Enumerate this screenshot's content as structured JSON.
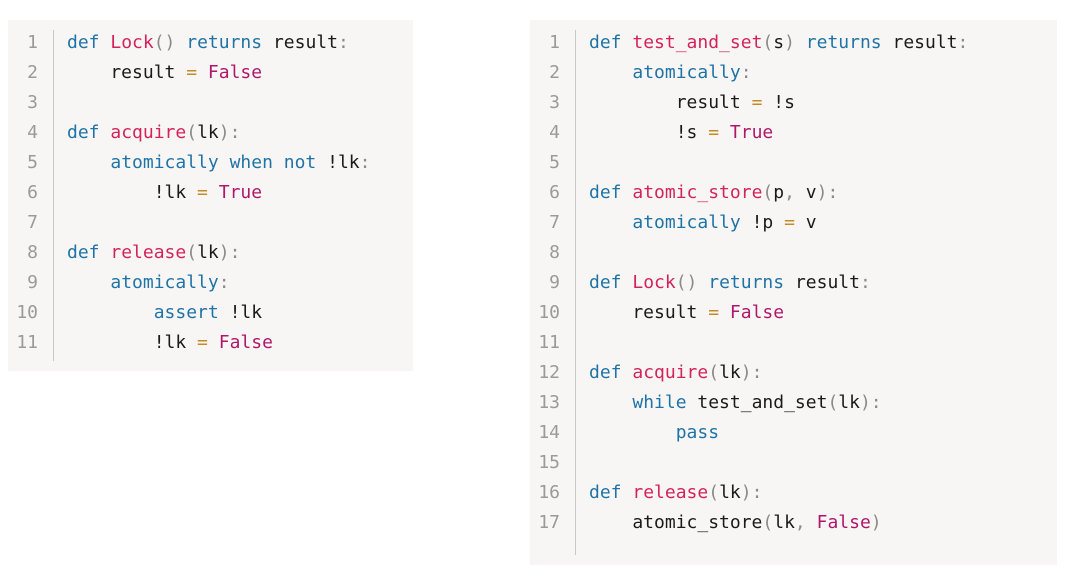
{
  "colors": {
    "keyword": "#1f73a6",
    "function": "#d4235c",
    "literal": "#b0176b",
    "operator": "#c48a2a",
    "punctuation": "#8a8a8a",
    "text": "#1a1a1a",
    "line_number": "#9a9a9a",
    "panel_background": "#f7f6f4"
  },
  "left_listing": {
    "lines": [
      {
        "n": "1",
        "tokens": [
          [
            "kw",
            "def "
          ],
          [
            "fn",
            "Lock"
          ],
          [
            "pn",
            "()"
          ],
          [
            "tx",
            " "
          ],
          [
            "kw",
            "returns"
          ],
          [
            "tx",
            " result"
          ],
          [
            "pn",
            ":"
          ]
        ]
      },
      {
        "n": "2",
        "tokens": [
          [
            "tx",
            "    result "
          ],
          [
            "op",
            "="
          ],
          [
            "tx",
            " "
          ],
          [
            "lit",
            "False"
          ]
        ]
      },
      {
        "n": "3",
        "tokens": []
      },
      {
        "n": "4",
        "tokens": [
          [
            "kw",
            "def "
          ],
          [
            "fn",
            "acquire"
          ],
          [
            "pn",
            "("
          ],
          [
            "tx",
            "lk"
          ],
          [
            "pn",
            "):"
          ]
        ]
      },
      {
        "n": "5",
        "tokens": [
          [
            "tx",
            "    "
          ],
          [
            "kw",
            "atomically when not"
          ],
          [
            "tx",
            " !lk"
          ],
          [
            "pn",
            ":"
          ]
        ]
      },
      {
        "n": "6",
        "tokens": [
          [
            "tx",
            "        !lk "
          ],
          [
            "op",
            "="
          ],
          [
            "tx",
            " "
          ],
          [
            "lit",
            "True"
          ]
        ]
      },
      {
        "n": "7",
        "tokens": []
      },
      {
        "n": "8",
        "tokens": [
          [
            "kw",
            "def "
          ],
          [
            "fn",
            "release"
          ],
          [
            "pn",
            "("
          ],
          [
            "tx",
            "lk"
          ],
          [
            "pn",
            "):"
          ]
        ]
      },
      {
        "n": "9",
        "tokens": [
          [
            "tx",
            "    "
          ],
          [
            "kw",
            "atomically"
          ],
          [
            "pn",
            ":"
          ]
        ]
      },
      {
        "n": "10",
        "tokens": [
          [
            "tx",
            "        "
          ],
          [
            "kw",
            "assert"
          ],
          [
            "tx",
            " !lk"
          ]
        ]
      },
      {
        "n": "11",
        "tokens": [
          [
            "tx",
            "        !lk "
          ],
          [
            "op",
            "="
          ],
          [
            "tx",
            " "
          ],
          [
            "lit",
            "False"
          ]
        ]
      }
    ]
  },
  "right_listing": {
    "lines": [
      {
        "n": "1",
        "tokens": [
          [
            "kw",
            "def "
          ],
          [
            "fn",
            "test_and_set"
          ],
          [
            "pn",
            "("
          ],
          [
            "tx",
            "s"
          ],
          [
            "pn",
            ")"
          ],
          [
            "tx",
            " "
          ],
          [
            "kw",
            "returns"
          ],
          [
            "tx",
            " result"
          ],
          [
            "pn",
            ":"
          ]
        ]
      },
      {
        "n": "2",
        "tokens": [
          [
            "tx",
            "    "
          ],
          [
            "kw",
            "atomically"
          ],
          [
            "pn",
            ":"
          ]
        ]
      },
      {
        "n": "3",
        "tokens": [
          [
            "tx",
            "        result "
          ],
          [
            "op",
            "="
          ],
          [
            "tx",
            " !s"
          ]
        ]
      },
      {
        "n": "4",
        "tokens": [
          [
            "tx",
            "        !s "
          ],
          [
            "op",
            "="
          ],
          [
            "tx",
            " "
          ],
          [
            "lit",
            "True"
          ]
        ]
      },
      {
        "n": "5",
        "tokens": []
      },
      {
        "n": "6",
        "tokens": [
          [
            "kw",
            "def "
          ],
          [
            "fn",
            "atomic_store"
          ],
          [
            "pn",
            "("
          ],
          [
            "tx",
            "p"
          ],
          [
            "pn",
            ","
          ],
          [
            "tx",
            " v"
          ],
          [
            "pn",
            "):"
          ]
        ]
      },
      {
        "n": "7",
        "tokens": [
          [
            "tx",
            "    "
          ],
          [
            "kw",
            "atomically"
          ],
          [
            "tx",
            " !p "
          ],
          [
            "op",
            "="
          ],
          [
            "tx",
            " v"
          ]
        ]
      },
      {
        "n": "8",
        "tokens": []
      },
      {
        "n": "9",
        "tokens": [
          [
            "kw",
            "def "
          ],
          [
            "fn",
            "Lock"
          ],
          [
            "pn",
            "()"
          ],
          [
            "tx",
            " "
          ],
          [
            "kw",
            "returns"
          ],
          [
            "tx",
            " result"
          ],
          [
            "pn",
            ":"
          ]
        ]
      },
      {
        "n": "10",
        "tokens": [
          [
            "tx",
            "    result "
          ],
          [
            "op",
            "="
          ],
          [
            "tx",
            " "
          ],
          [
            "lit",
            "False"
          ]
        ]
      },
      {
        "n": "11",
        "tokens": []
      },
      {
        "n": "12",
        "tokens": [
          [
            "kw",
            "def "
          ],
          [
            "fn",
            "acquire"
          ],
          [
            "pn",
            "("
          ],
          [
            "tx",
            "lk"
          ],
          [
            "pn",
            "):"
          ]
        ]
      },
      {
        "n": "13",
        "tokens": [
          [
            "tx",
            "    "
          ],
          [
            "kw",
            "while"
          ],
          [
            "tx",
            " test_and_set"
          ],
          [
            "pn",
            "("
          ],
          [
            "tx",
            "lk"
          ],
          [
            "pn",
            "):"
          ]
        ]
      },
      {
        "n": "14",
        "tokens": [
          [
            "tx",
            "        "
          ],
          [
            "kw",
            "pass"
          ]
        ]
      },
      {
        "n": "15",
        "tokens": []
      },
      {
        "n": "16",
        "tokens": [
          [
            "kw",
            "def "
          ],
          [
            "fn",
            "release"
          ],
          [
            "pn",
            "("
          ],
          [
            "tx",
            "lk"
          ],
          [
            "pn",
            "):"
          ]
        ]
      },
      {
        "n": "17",
        "tokens": [
          [
            "tx",
            "    atomic_store"
          ],
          [
            "pn",
            "("
          ],
          [
            "tx",
            "lk"
          ],
          [
            "pn",
            ","
          ],
          [
            "tx",
            " "
          ],
          [
            "lit",
            "False"
          ],
          [
            "pn",
            ")"
          ]
        ]
      }
    ]
  }
}
